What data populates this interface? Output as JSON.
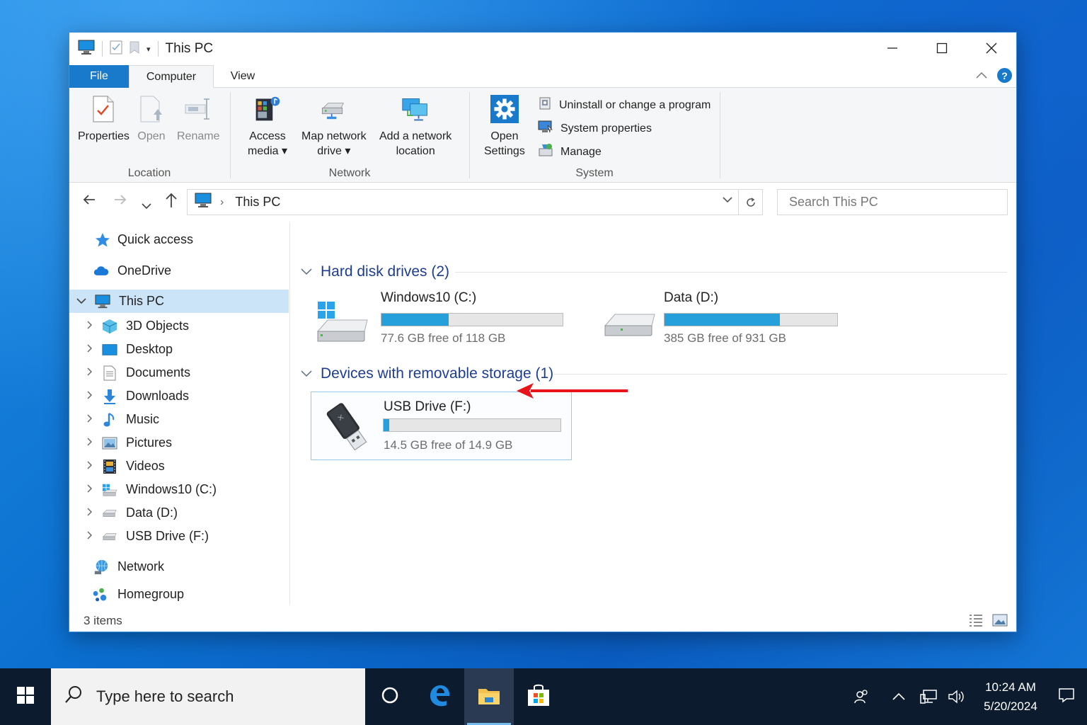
{
  "window": {
    "title": "This PC",
    "controls": {
      "minimize": "—",
      "maximize": "☐",
      "close": "✕"
    }
  },
  "ribbon": {
    "tabs": [
      {
        "label": "File"
      },
      {
        "label": "Computer"
      },
      {
        "label": "View"
      }
    ],
    "help": "?",
    "groups": {
      "location": {
        "label": "Location",
        "buttons": [
          {
            "label": "Properties",
            "icon": "properties-icon"
          },
          {
            "label": "Open",
            "icon": "open-icon"
          },
          {
            "label": "Rename",
            "icon": "rename-icon"
          }
        ]
      },
      "network": {
        "label": "Network",
        "buttons": [
          {
            "line1": "Access",
            "line2": "media ▾",
            "icon": "access-media-icon"
          },
          {
            "line1": "Map network",
            "line2": "drive ▾",
            "icon": "map-network-drive-icon"
          },
          {
            "line1": "Add a network",
            "line2": "location",
            "icon": "add-network-location-icon"
          }
        ]
      },
      "system": {
        "label": "System",
        "open_settings_1": "Open",
        "open_settings_2": "Settings",
        "items": [
          {
            "label": "Uninstall or change a program",
            "icon": "uninstall-icon"
          },
          {
            "label": "System properties",
            "icon": "system-properties-icon"
          },
          {
            "label": "Manage",
            "icon": "manage-icon"
          }
        ]
      }
    }
  },
  "address": {
    "path": "This PC",
    "separator": "›",
    "search_placeholder": "Search This PC"
  },
  "nav": {
    "items": [
      {
        "label": "Quick access",
        "icon": "star-icon"
      },
      {
        "label": "OneDrive",
        "icon": "cloud-icon"
      },
      {
        "label": "This PC",
        "icon": "computer-icon",
        "selected": true
      },
      {
        "label": "3D Objects",
        "icon": "cube-icon"
      },
      {
        "label": "Desktop",
        "icon": "desktop-icon"
      },
      {
        "label": "Documents",
        "icon": "document-icon"
      },
      {
        "label": "Downloads",
        "icon": "download-icon"
      },
      {
        "label": "Music",
        "icon": "music-icon"
      },
      {
        "label": "Pictures",
        "icon": "pictures-icon"
      },
      {
        "label": "Videos",
        "icon": "videos-icon"
      },
      {
        "label": "Windows10 (C:)",
        "icon": "windows-drive-icon"
      },
      {
        "label": "Data (D:)",
        "icon": "drive-icon"
      },
      {
        "label": "USB Drive (F:)",
        "icon": "usb-drive-icon"
      },
      {
        "label": "Network",
        "icon": "network-icon"
      },
      {
        "label": "Homegroup",
        "icon": "homegroup-icon"
      }
    ]
  },
  "content": {
    "hard_disks": {
      "header": "Hard disk drives (2)",
      "drives": [
        {
          "name": "Windows10 (C:)",
          "free": "77.6 GB free of 118 GB",
          "used_fraction": 0.37
        },
        {
          "name": "Data (D:)",
          "free": "385 GB free of 931 GB",
          "used_fraction": 0.67
        }
      ]
    },
    "removable": {
      "header": "Devices with removable storage (1)",
      "drives": [
        {
          "name": "USB Drive (F:)",
          "free": "14.5 GB free of 14.9 GB",
          "used_fraction": 0.03
        }
      ]
    }
  },
  "status": {
    "items_count": "3 items"
  },
  "taskbar": {
    "search_placeholder": "Type here to search",
    "time": "10:24 AM",
    "date": "5/20/2024"
  },
  "colors": {
    "accent": "#1979ca",
    "drive_fill": "#26a0da",
    "arrow": "#e8141a"
  }
}
